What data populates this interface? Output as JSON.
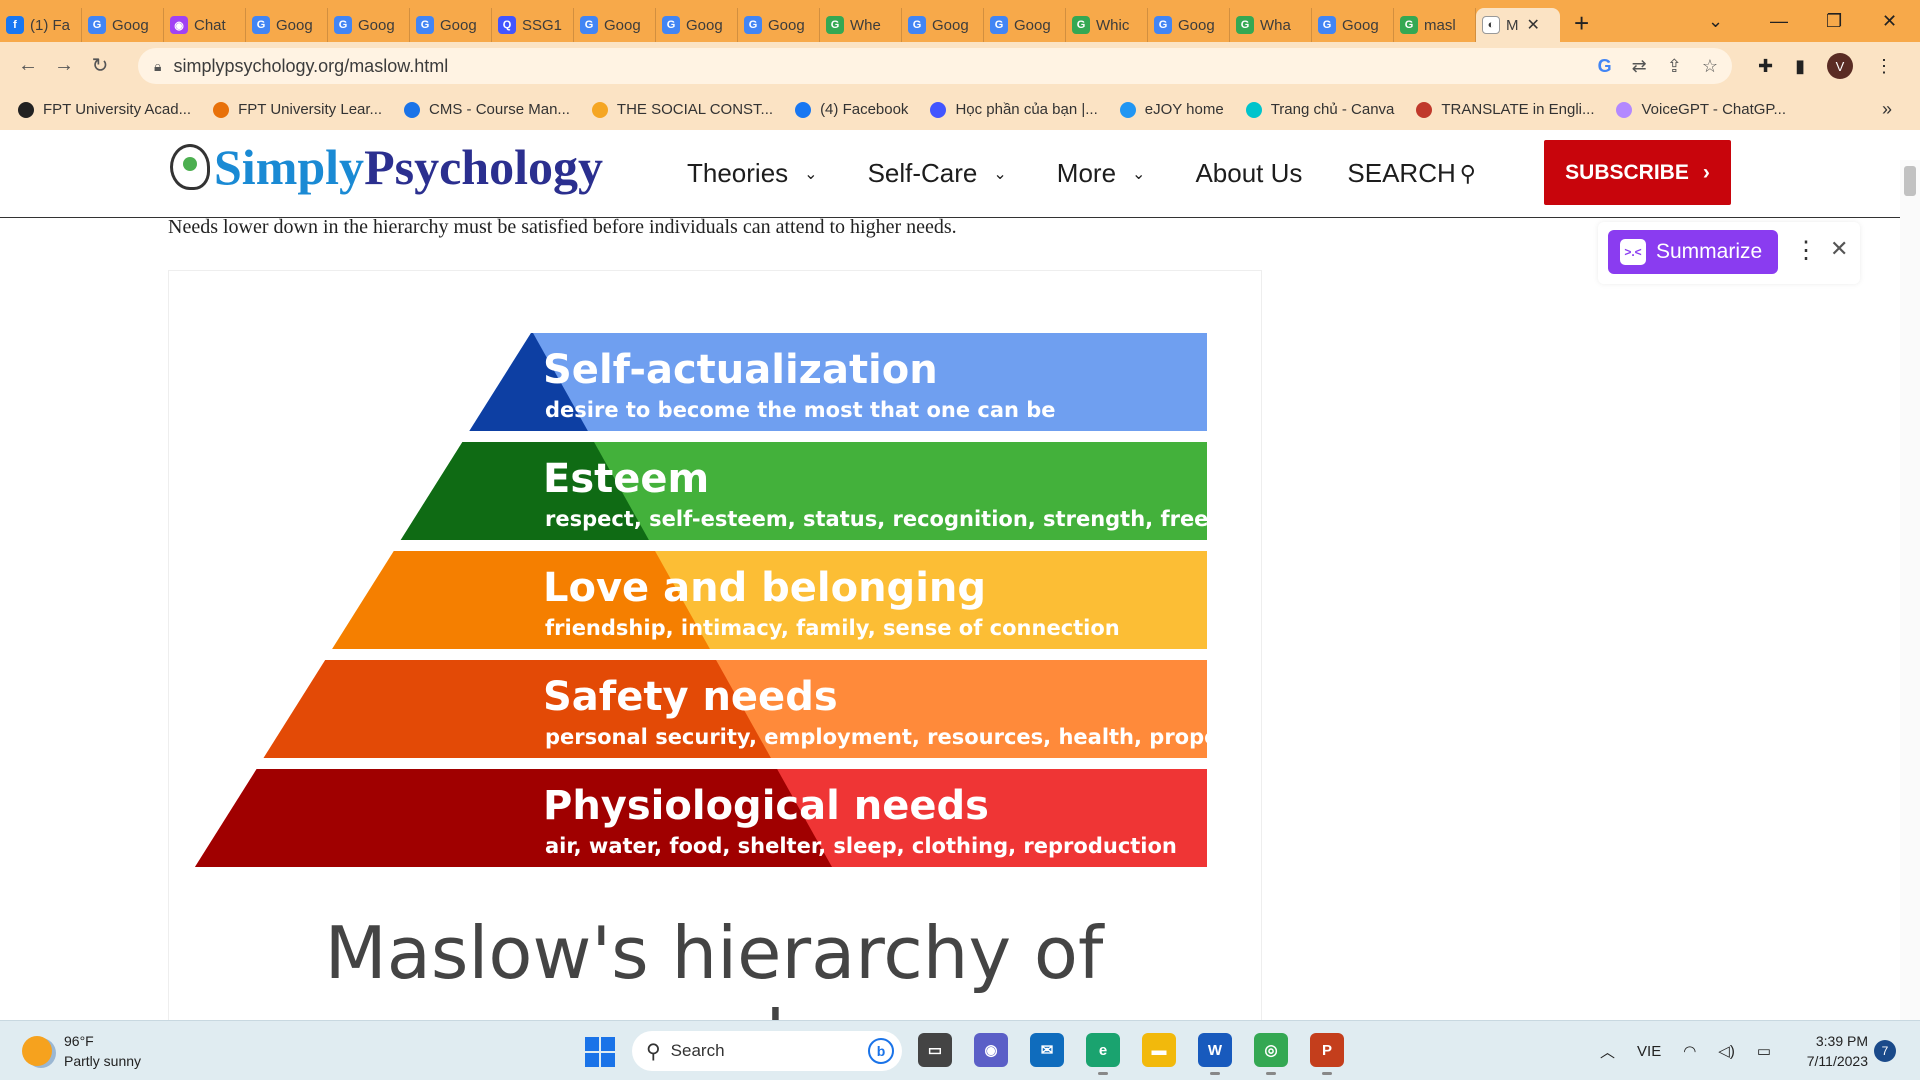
{
  "tabs": [
    {
      "label": "(1) Fa",
      "icon": "facebook-icon",
      "color": "#1877f2",
      "glyph": "f"
    },
    {
      "label": "Goog",
      "icon": "google-translate-icon",
      "color": "#4285f4",
      "glyph": "G"
    },
    {
      "label": "Chat",
      "icon": "chat-icon",
      "color": "#a142f4",
      "glyph": "◉"
    },
    {
      "label": "Goog",
      "icon": "google-translate-icon",
      "color": "#4285f4",
      "glyph": "G"
    },
    {
      "label": "Goog",
      "icon": "google-translate-icon",
      "color": "#4285f4",
      "glyph": "G"
    },
    {
      "label": "Goog",
      "icon": "google-translate-icon",
      "color": "#4285f4",
      "glyph": "G"
    },
    {
      "label": "SSG1",
      "icon": "quizlet-icon",
      "color": "#4255ff",
      "glyph": "Q"
    },
    {
      "label": "Goog",
      "icon": "google-translate-icon",
      "color": "#4285f4",
      "glyph": "G"
    },
    {
      "label": "Goog",
      "icon": "google-translate-icon",
      "color": "#4285f4",
      "glyph": "G"
    },
    {
      "label": "Goog",
      "icon": "google-translate-icon",
      "color": "#4285f4",
      "glyph": "G"
    },
    {
      "label": "Whe",
      "icon": "google-icon",
      "color": "#34a853",
      "glyph": "G"
    },
    {
      "label": "Goog",
      "icon": "google-translate-icon",
      "color": "#4285f4",
      "glyph": "G"
    },
    {
      "label": "Goog",
      "icon": "google-translate-icon",
      "color": "#4285f4",
      "glyph": "G"
    },
    {
      "label": "Whic",
      "icon": "google-icon",
      "color": "#34a853",
      "glyph": "G"
    },
    {
      "label": "Goog",
      "icon": "google-translate-icon",
      "color": "#4285f4",
      "glyph": "G"
    },
    {
      "label": "Wha",
      "icon": "google-icon",
      "color": "#34a853",
      "glyph": "G"
    },
    {
      "label": "Goog",
      "icon": "google-translate-icon",
      "color": "#4285f4",
      "glyph": "G"
    },
    {
      "label": "masl",
      "icon": "google-icon",
      "color": "#34a853",
      "glyph": "G"
    }
  ],
  "active_tab": {
    "label": "M",
    "icon": "simplypsychology-icon"
  },
  "url": "simplypsychology.org/maslow.html",
  "bookmarks": [
    {
      "label": "FPT University Acad...",
      "color": "#222"
    },
    {
      "label": "FPT University Lear...",
      "color": "#e8710a"
    },
    {
      "label": "CMS - Course Man...",
      "color": "#1a73e8"
    },
    {
      "label": "THE SOCIAL CONST...",
      "color": "#f5a623"
    },
    {
      "label": "(4) Facebook",
      "color": "#1877f2"
    },
    {
      "label": "Học phần của bạn |...",
      "color": "#4255ff"
    },
    {
      "label": "eJOY home",
      "color": "#2196f3"
    },
    {
      "label": "Trang chủ - Canva",
      "color": "#00c4cc"
    },
    {
      "label": "TRANSLATE in Engli...",
      "color": "#c0392b"
    },
    {
      "label": "VoiceGPT - ChatGP...",
      "color": "#b388ff"
    }
  ],
  "site": {
    "logo_part1": "Simply",
    "logo_part2": "Psychology",
    "nav": [
      "Theories",
      "Self-Care",
      "More",
      "About Us"
    ],
    "search_label": "SEARCH",
    "subscribe_label": "SUBSCRIBE"
  },
  "content": {
    "intro": "Needs lower down in the hierarchy must be satisfied before individuals can attend to higher needs.",
    "figure_title": "Maslow's hierarchy of needs"
  },
  "pyramid": [
    {
      "title": "Self-actualization",
      "desc": "desire to become the most that one can be",
      "dark": "#0d3fa3",
      "light": "#6f9ff0"
    },
    {
      "title": "Esteem",
      "desc": "respect, self-esteem, status, recognition, strength, freedom",
      "dark": "#0f6b14",
      "light": "#43b13b"
    },
    {
      "title": "Love and belonging",
      "desc": "friendship, intimacy, family, sense of connection",
      "dark": "#f57f00",
      "light": "#fcbe35"
    },
    {
      "title": "Safety needs",
      "desc": "personal security, employment, resources, health, property",
      "dark": "#e34a06",
      "light": "#ff8a3a"
    },
    {
      "title": "Physiological needs",
      "desc": "air, water, food, shelter, sleep, clothing, reproduction",
      "dark": "#a00000",
      "light": "#ef3535"
    }
  ],
  "summarize": {
    "label": "Summarize"
  },
  "taskbar": {
    "temp": "96°F",
    "weather": "Partly sunny",
    "search_placeholder": "Search",
    "language": "VIE",
    "time": "3:39 PM",
    "date": "7/11/2023",
    "notifications": "7"
  },
  "taskbar_apps": [
    {
      "name": "file-explorer-icon",
      "color": "#444",
      "glyph": "▭"
    },
    {
      "name": "teams-icon",
      "color": "#5b5fc7",
      "glyph": "◉"
    },
    {
      "name": "mail-icon",
      "color": "#0f6cbd",
      "glyph": "✉"
    },
    {
      "name": "edge-icon",
      "color": "#1aa36f",
      "glyph": "e"
    },
    {
      "name": "folder-icon",
      "color": "#f2b90c",
      "glyph": "▬"
    },
    {
      "name": "word-icon",
      "color": "#185abd",
      "glyph": "W"
    },
    {
      "name": "chrome-icon",
      "color": "#34a853",
      "glyph": "◎"
    },
    {
      "name": "powerpoint-icon",
      "color": "#c43e1c",
      "glyph": "P"
    }
  ]
}
